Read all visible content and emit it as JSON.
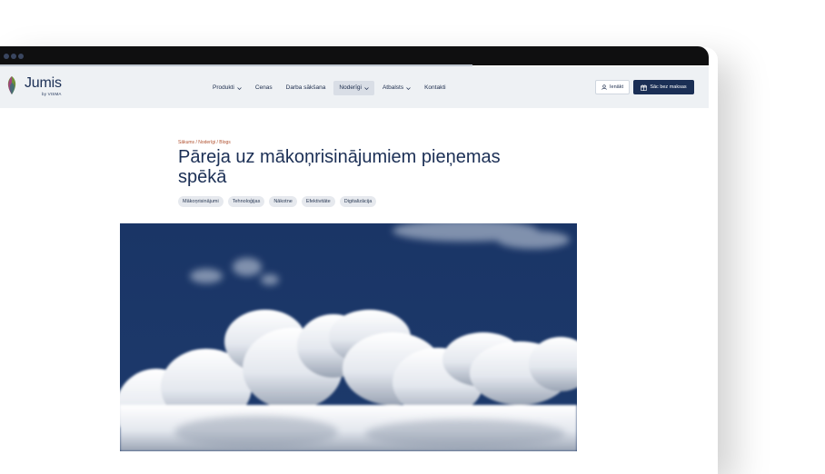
{
  "brand": {
    "name": "Jumis",
    "sub": "by VISMA"
  },
  "nav": {
    "items": [
      {
        "label": "Produkti",
        "dropdown": true,
        "active": false
      },
      {
        "label": "Cenas",
        "dropdown": false,
        "active": false
      },
      {
        "label": "Darba sākšana",
        "dropdown": false,
        "active": false
      },
      {
        "label": "Noderīgi",
        "dropdown": true,
        "active": true
      },
      {
        "label": "Atbalsts",
        "dropdown": true,
        "active": false
      },
      {
        "label": "Kontakti",
        "dropdown": false,
        "active": false
      }
    ],
    "login_label": "Ienākt",
    "cta_label": "Sāc bez maksas"
  },
  "article": {
    "breadcrumb": "Sākums / Noderīgi / Blogs",
    "title": "Pāreja uz mākoņrisinājumiem pieņemas spēkā",
    "tags": [
      "Mākoņrisinājumi",
      "Tehnoloģijas",
      "Nākotne",
      "Efektivitāte",
      "Digitalizācija"
    ]
  },
  "colors": {
    "brand": "#1b2f55",
    "breadcrumb": "#b0502f",
    "navbar_bg": "#eef1f4",
    "sky": "#1a3566"
  }
}
